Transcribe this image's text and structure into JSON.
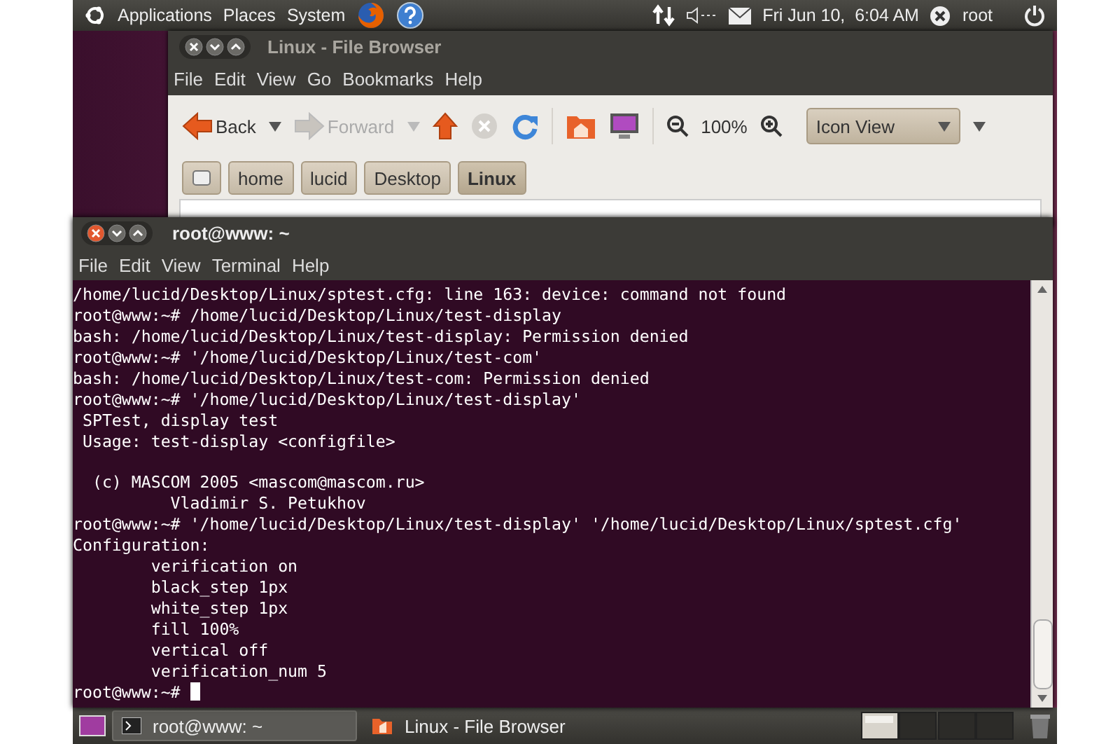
{
  "top_panel": {
    "menus": [
      "Applications",
      "Places",
      "System"
    ],
    "clock": "Fri Jun 10,  6:04 AM",
    "user": "root"
  },
  "file_browser": {
    "title": "Linux - File Browser",
    "menus": [
      "File",
      "Edit",
      "View",
      "Go",
      "Bookmarks",
      "Help"
    ],
    "nav_buttons": [
      {
        "label": "Back",
        "disabled": false
      },
      {
        "label": "Forward",
        "disabled": true
      }
    ],
    "zoom": "100%",
    "view_mode": "Icon View",
    "path_buttons": [
      {
        "label": "home",
        "selected": false
      },
      {
        "label": "lucid",
        "selected": false
      },
      {
        "label": "Desktop",
        "selected": false
      },
      {
        "label": "Linux",
        "selected": true
      }
    ]
  },
  "terminal": {
    "title": "root@www: ~",
    "menus": [
      "File",
      "Edit",
      "View",
      "Terminal",
      "Help"
    ],
    "blocks": [
      [
        "/home/lucid/Desktop/Linux/sptest.cfg: line 163: device: command not found",
        "root@www:~# /home/lucid/Desktop/Linux/test-display",
        "bash: /home/lucid/Desktop/Linux/test-display: Permission denied",
        "root@www:~# '/home/lucid/Desktop/Linux/test-com'",
        "bash: /home/lucid/Desktop/Linux/test-com: Permission denied",
        "root@www:~# '/home/lucid/Desktop/Linux/test-display'",
        " SPTest, display test",
        " Usage: test-display <configfile>"
      ],
      [
        "  (c) MASCOM 2005 <mascom@mascom.ru>",
        "          Vladimir S. Petukhov",
        "root@www:~# '/home/lucid/Desktop/Linux/test-display' '/home/lucid/Desktop/Linux/sptest.cfg'",
        "Configuration:",
        "        verification on",
        "        black_step 1px",
        "        white_step 1px",
        "        fill 100%",
        "        vertical off",
        "        verification_num 5"
      ]
    ],
    "prompt": "root@www:~# "
  },
  "taskbar": [
    {
      "kind": "terminal",
      "label": "root@www: ~",
      "selected": true
    },
    {
      "kind": "folder",
      "label": "Linux - File Browser",
      "selected": false
    }
  ]
}
